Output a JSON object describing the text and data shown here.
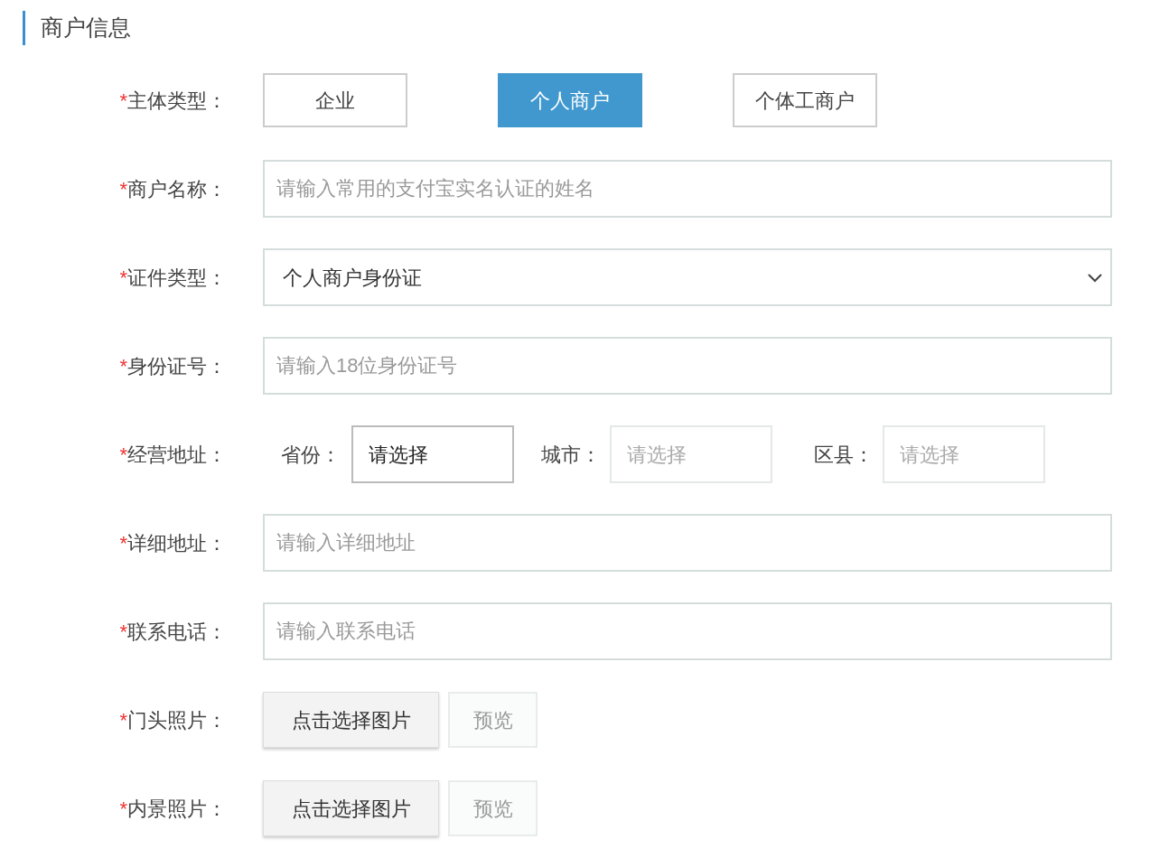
{
  "section": {
    "title": "商户信息"
  },
  "fields": [
    {
      "kind": "choice",
      "required_mark": "*",
      "label": "主体类型：",
      "options": [
        {
          "label": "企业",
          "selected": false
        },
        {
          "label": "个人商户",
          "selected": true
        },
        {
          "label": "个体工商户",
          "selected": false
        }
      ]
    },
    {
      "kind": "text",
      "required_mark": "*",
      "label": "商户名称：",
      "placeholder": "请输入常用的支付宝实名认证的姓名"
    },
    {
      "kind": "select",
      "required_mark": "*",
      "label": "证件类型：",
      "value": "个人商户身份证"
    },
    {
      "kind": "text",
      "required_mark": "*",
      "label": "身份证号：",
      "placeholder": "请输入18位身份证号"
    },
    {
      "kind": "address",
      "required_mark": "*",
      "label": "经营地址：",
      "parts": [
        {
          "label": "省份：",
          "text": "请选择",
          "disabled": false
        },
        {
          "label": "城市：",
          "text": "请选择",
          "disabled": true
        },
        {
          "label": "区县：",
          "text": "请选择",
          "disabled": true
        }
      ]
    },
    {
      "kind": "text",
      "required_mark": "*",
      "label": "详细地址：",
      "placeholder": "请输入详细地址"
    },
    {
      "kind": "text",
      "required_mark": "*",
      "label": "联系电话：",
      "placeholder": "请输入联系电话"
    },
    {
      "kind": "upload",
      "required_mark": "*",
      "label": "门头照片：",
      "button": "点击选择图片",
      "preview": {
        "label": "预览",
        "disabled": true
      }
    },
    {
      "kind": "upload",
      "required_mark": "*",
      "label": "内景照片：",
      "button": "点击选择图片",
      "preview": {
        "label": "预览",
        "disabled": true
      }
    }
  ]
}
